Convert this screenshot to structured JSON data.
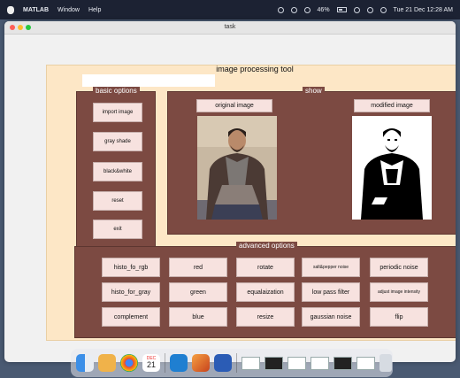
{
  "menubar": {
    "app": "MATLAB",
    "items": [
      "Window",
      "Help"
    ],
    "battery": "46%",
    "datetime": "Tue 21 Dec  12:28 AM"
  },
  "window": {
    "title": "task"
  },
  "app": {
    "title": "image processing tool",
    "basic_options": {
      "title": "basic options",
      "buttons": [
        "import image",
        "gray shade",
        "black&white",
        "reset",
        "exit"
      ]
    },
    "show": {
      "title": "show",
      "original_label": "original image",
      "modified_label": "modified image"
    },
    "advanced_options": {
      "title": "advanced options",
      "rows": [
        [
          "histo_fo_rgb",
          "red",
          "rotate",
          "salt&pepper noise",
          "periodic noise"
        ],
        [
          "histo_for_gray",
          "green",
          "equalaization",
          "low pass filter",
          "adjust image intensity"
        ],
        [
          "complement",
          "blue",
          "resize",
          "gaussian noise",
          "flip"
        ]
      ]
    }
  },
  "dock": {
    "calendar_month": "DEC",
    "calendar_day": "21"
  },
  "colors": {
    "panel_bg": "#fde7c6",
    "group_bg": "#7c4a42",
    "button_bg": "#f7e2df",
    "window_bg": "#f1f1f1"
  }
}
